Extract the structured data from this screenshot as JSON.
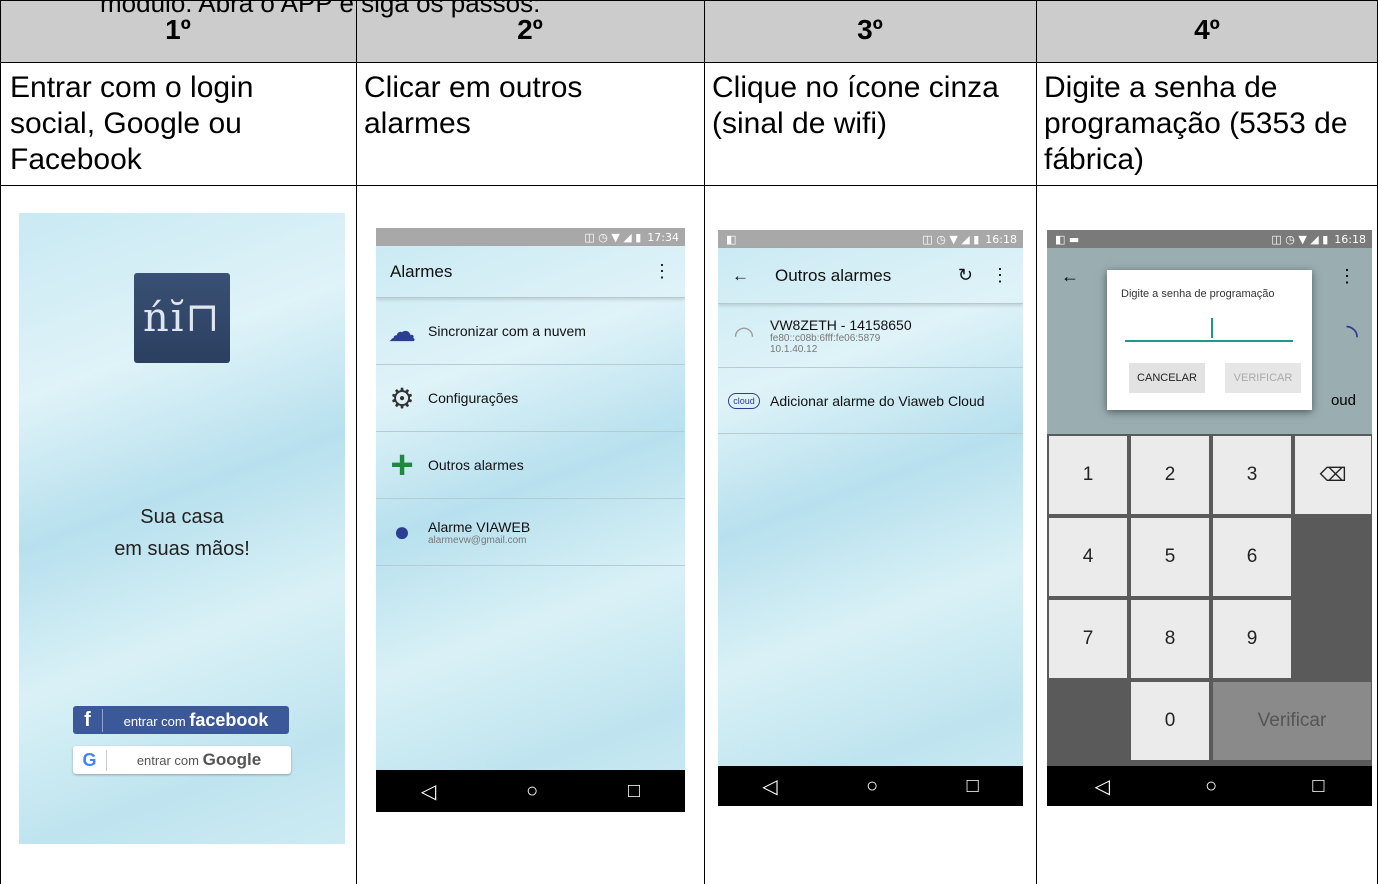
{
  "intro_text": "modulo. Abra o APP e siga os passos:",
  "steps": [
    {
      "header": "1º",
      "description": "Entrar com o login social, Google ou Facebook"
    },
    {
      "header": "2º",
      "description": "Clicar em outros alarmes"
    },
    {
      "header": "3º",
      "description": "Clique no ícone cinza (sinal de wifi)"
    },
    {
      "header": "4º",
      "description": "Digite a senha de programação (5353 de fábrica)"
    }
  ],
  "screen1": {
    "slogan_line1": "Sua casa",
    "slogan_line2": "em suas mãos!",
    "facebook_prefix": "entrar com",
    "facebook_brand": "facebook",
    "google_prefix": "entrar com",
    "google_brand": "Google"
  },
  "screen2": {
    "time": "17:34",
    "title": "Alarmes",
    "items": [
      {
        "label": "Sincronizar com a nuvem"
      },
      {
        "label": "Configurações"
      },
      {
        "label": "Outros alarmes"
      },
      {
        "label": "Alarme VIAWEB",
        "sub": "alarmevw@gmail.com"
      }
    ]
  },
  "screen3": {
    "time": "16:18",
    "title": "Outros alarmes",
    "device_name": "VW8ZETH - 14158650",
    "device_ipv6": "fe80::c08b:6fff:fe06:5879",
    "device_ip": "10.1.40.12",
    "cloud_badge": "cloud",
    "add_cloud": "Adicionar alarme do Viaweb Cloud"
  },
  "screen4": {
    "time": "16:18",
    "dialog_title": "Digite a senha de programação",
    "cancel": "CANCELAR",
    "verify_btn": "VERIFICAR",
    "bg_partial_text": "oud",
    "keys": [
      "1",
      "2",
      "3",
      "4",
      "5",
      "6",
      "7",
      "8",
      "9",
      "0"
    ],
    "verify_key": "Verificar"
  },
  "colors": {
    "header_bg": "#cccccc",
    "facebook": "#3b5998",
    "accent": "#1b9a8a"
  }
}
